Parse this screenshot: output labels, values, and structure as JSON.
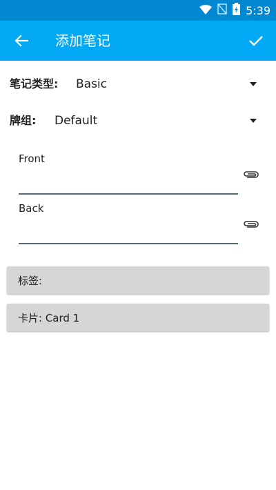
{
  "status_bar": {
    "time": "5:39"
  },
  "app_bar": {
    "title": "添加笔记"
  },
  "note_type": {
    "label": "笔记类型:",
    "value": "Basic"
  },
  "deck": {
    "label": "牌组:",
    "value": "Default"
  },
  "fields": [
    {
      "label": "Front",
      "value": ""
    },
    {
      "label": "Back",
      "value": ""
    }
  ],
  "tags_button": {
    "label": "标签:"
  },
  "cards_button": {
    "label": "卡片: Card 1"
  },
  "colors": {
    "status_bar": "#0288d1",
    "app_bar": "#03a9f4",
    "button_bg": "#d6d6d6",
    "underline": "#5a6a72"
  }
}
